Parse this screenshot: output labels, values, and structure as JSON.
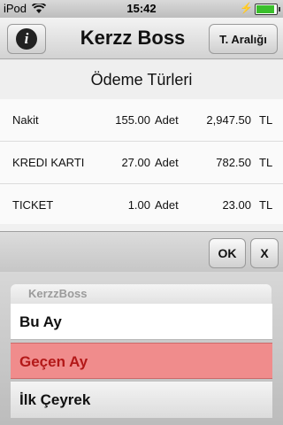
{
  "status_bar": {
    "carrier": "iPod",
    "time": "15:42",
    "battery_level": 0.9
  },
  "nav": {
    "title": "Kerzz Boss",
    "info_icon": "info-icon",
    "range_button": "T. Aralığı"
  },
  "table": {
    "title": "Ödeme Türleri",
    "rows": [
      {
        "name": "Nakit",
        "qty": "155.00",
        "unit": "Adet",
        "amount": "2,947.50",
        "currency": "TL"
      },
      {
        "name": "KREDI KARTI",
        "qty": "27.00",
        "unit": "Adet",
        "amount": "782.50",
        "currency": "TL"
      },
      {
        "name": "TICKET",
        "qty": "1.00",
        "unit": "Adet",
        "amount": "23.00",
        "currency": "TL"
      }
    ]
  },
  "toolbar": {
    "ok": "OK",
    "close": "X"
  },
  "picker": {
    "header": "KerzzBoss",
    "options": [
      "Bu Ay",
      "Geçen Ay",
      "İlk Çeyrek"
    ],
    "selected": "Geçen Ay"
  }
}
